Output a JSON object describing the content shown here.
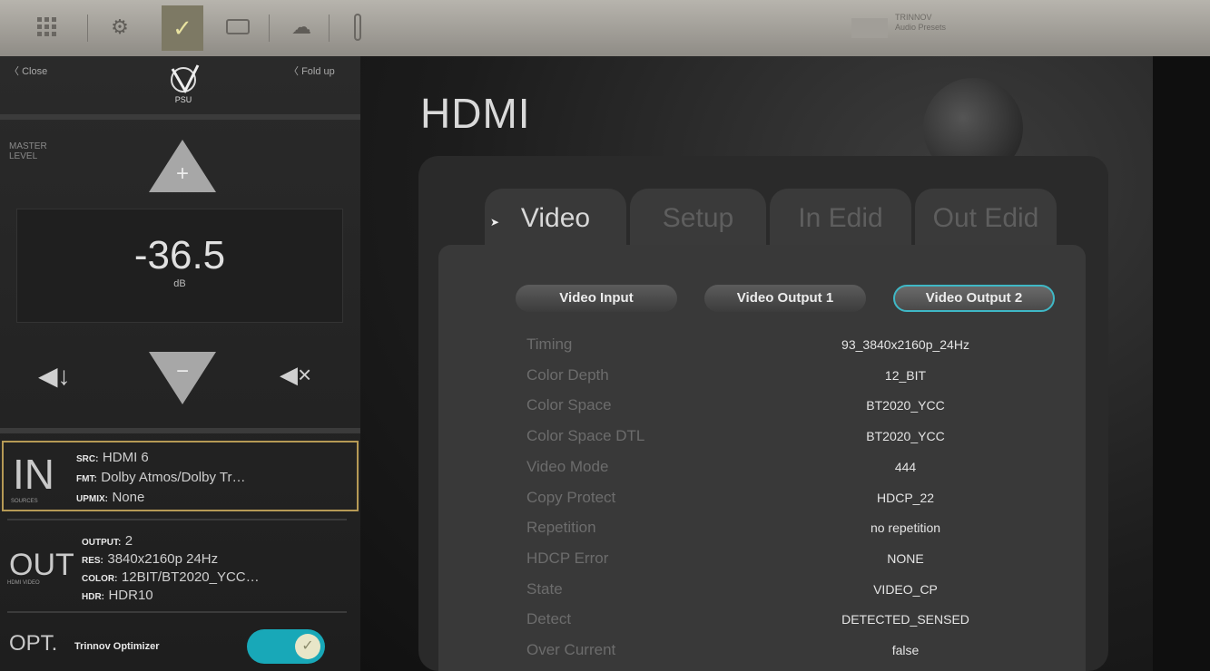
{
  "toolbar": {
    "brand_lines": [
      "TRINNOV",
      "Audio Presets"
    ],
    "icons": [
      "grid-icon",
      "settings-icon",
      "check-icon",
      "display-icon",
      "cloud-icon",
      "remote-icon"
    ]
  },
  "left": {
    "close": "Close",
    "fold_up": "Fold up",
    "logo_text": "PSU",
    "master_label": "MASTER LEVEL",
    "level_value": "-36.5",
    "level_unit": "dB",
    "plus": "+",
    "minus": "−",
    "in": {
      "letters": "IN",
      "sub": "SOURCES",
      "src_label": "SRC:",
      "src_value": "HDMI 6",
      "fmt_label": "FMT:",
      "fmt_value": "Dolby Atmos/Dolby Tr…",
      "upmix_label": "UPMIX:",
      "upmix_value": "None"
    },
    "out": {
      "letters": "OUT",
      "sub": "HDMI VIDEO",
      "output_label": "OUTPUT:",
      "output_value": "2",
      "res_label": "RES:",
      "res_value": "3840x2160p 24Hz",
      "color_label": "COLOR:",
      "color_value": "12BIT/BT2020_YCC…",
      "hdr_label": "HDR:",
      "hdr_value": "HDR10"
    },
    "opt": {
      "letters": "OPT.",
      "label": "Trinnov Optimizer",
      "enabled": true
    }
  },
  "main": {
    "title": "HDMI",
    "tabs": [
      "Video",
      "Setup",
      "In Edid",
      "Out Edid"
    ],
    "active_tab": "Video",
    "subtabs": [
      "Video Input",
      "Video Output 1",
      "Video Output 2"
    ],
    "active_subtab": "Video Output 2",
    "properties": [
      {
        "name": "Timing",
        "value": "93_3840x2160p_24Hz"
      },
      {
        "name": "Color Depth",
        "value": "12_BIT"
      },
      {
        "name": "Color Space",
        "value": "BT2020_YCC"
      },
      {
        "name": "Color Space DTL",
        "value": "BT2020_YCC"
      },
      {
        "name": "Video Mode",
        "value": "444"
      },
      {
        "name": "Copy Protect",
        "value": "HDCP_22"
      },
      {
        "name": "Repetition",
        "value": "no repetition"
      },
      {
        "name": "HDCP Error",
        "value": "NONE"
      },
      {
        "name": "State",
        "value": "VIDEO_CP"
      },
      {
        "name": "Detect",
        "value": "DETECTED_SENSED"
      },
      {
        "name": "Over Current",
        "value": "false"
      }
    ]
  },
  "colors": {
    "accent": "#18a8b8",
    "highlight_border": "#b69a55"
  }
}
